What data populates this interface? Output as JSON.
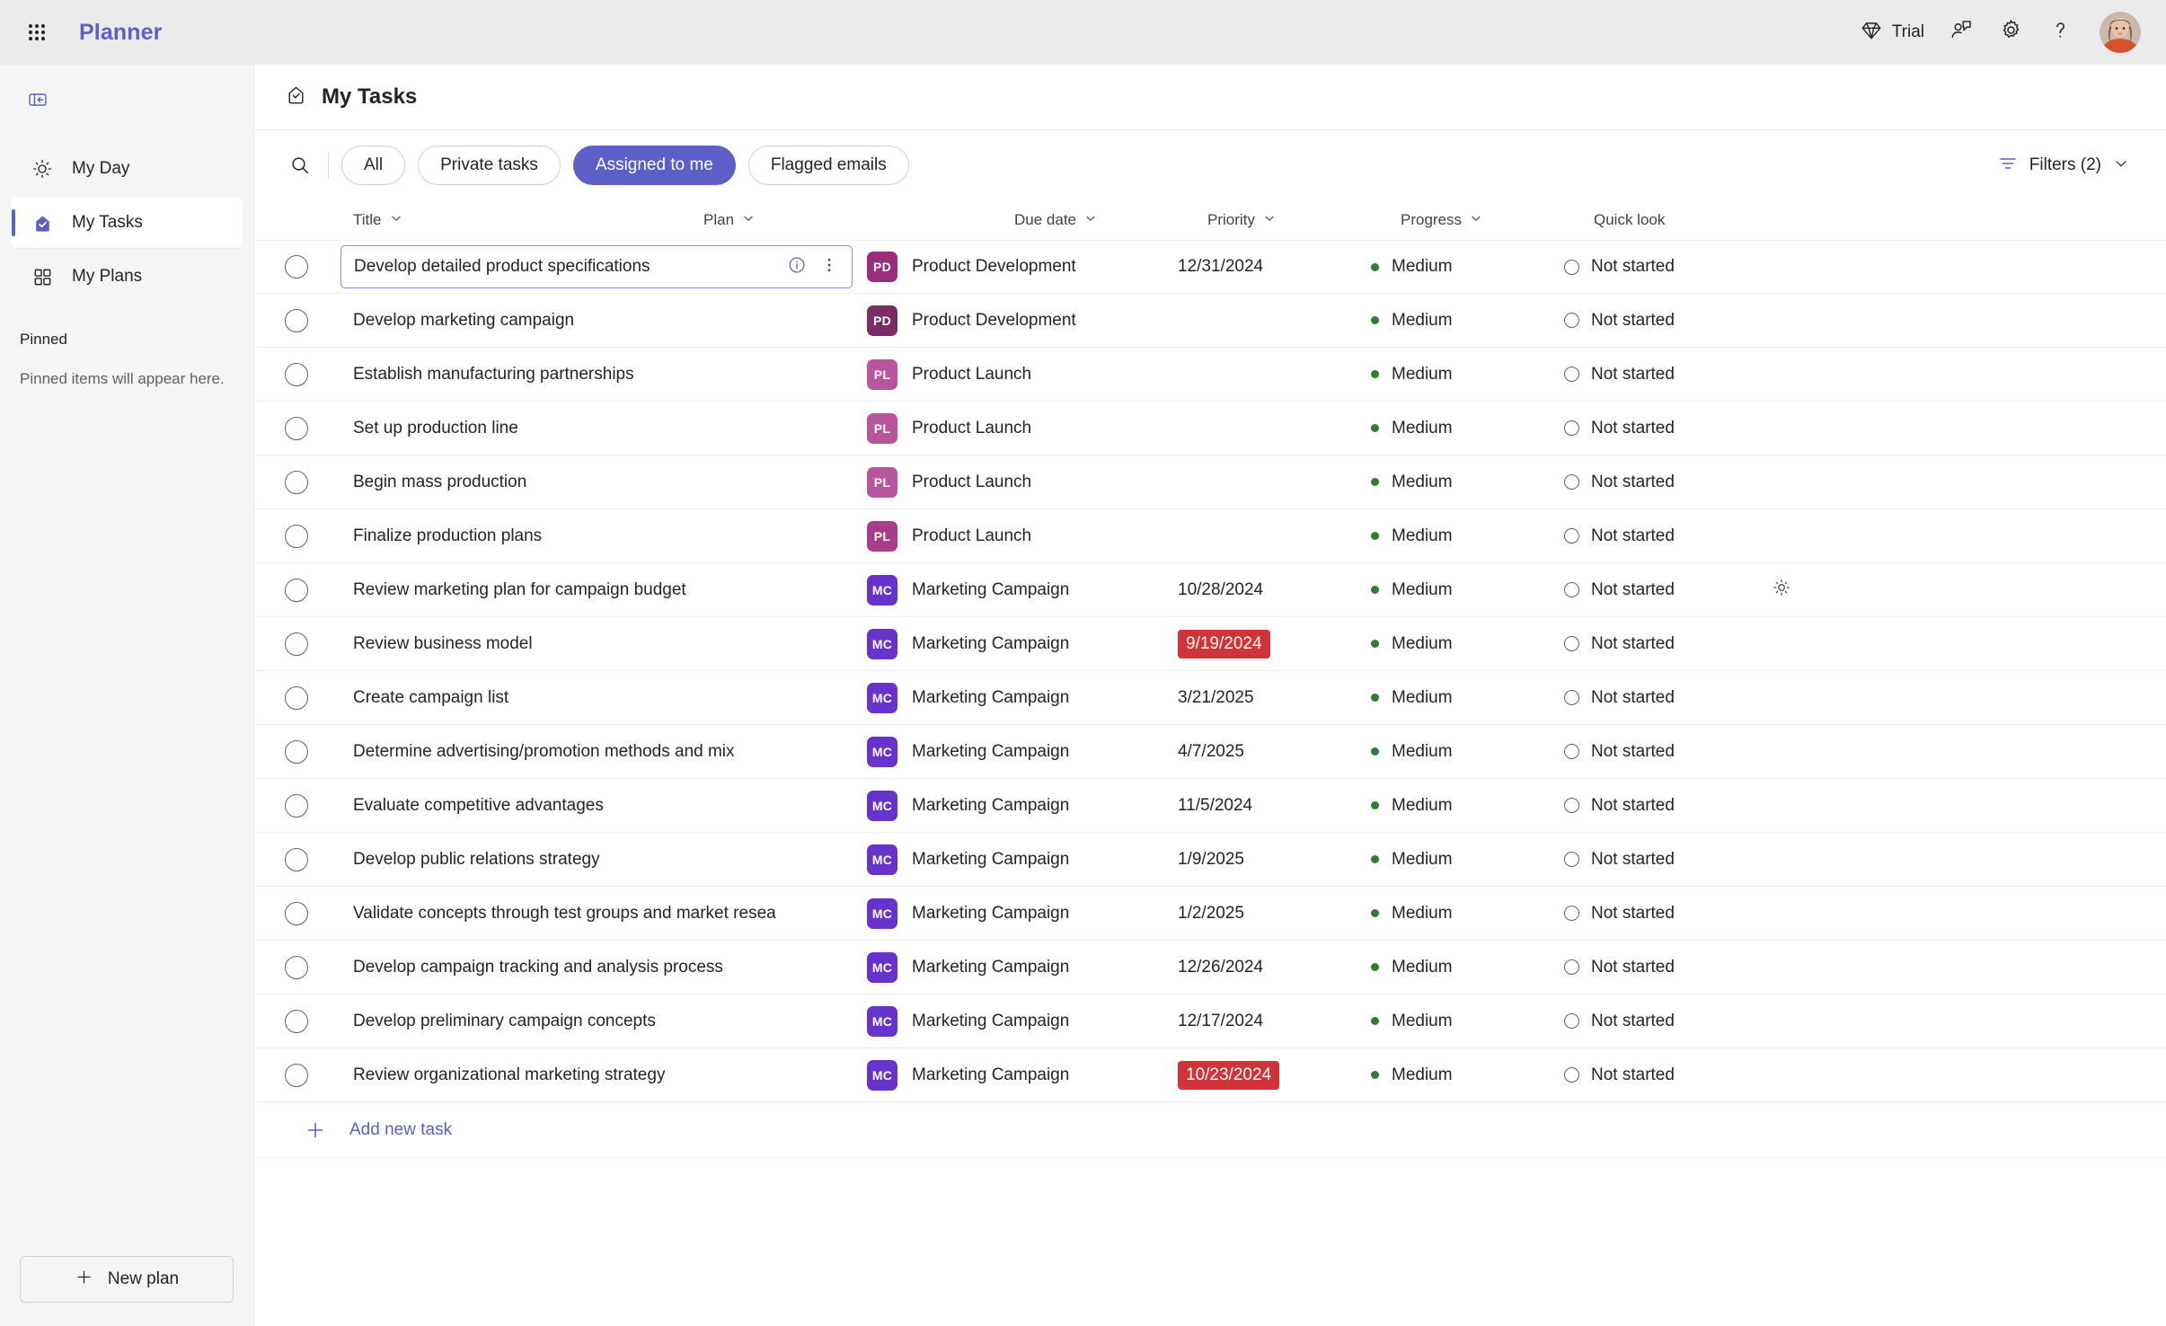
{
  "topbar": {
    "waffle_label": "app-launcher",
    "app_title": "Planner",
    "trial_label": "Trial",
    "icons": [
      "diamond-icon",
      "feedback-icon",
      "gear-icon",
      "help-icon",
      "avatar"
    ]
  },
  "sidebar": {
    "collapse_label": "collapse-navigation",
    "items": [
      {
        "label": "My Day",
        "icon": "sun-icon",
        "active": false
      },
      {
        "label": "My Tasks",
        "icon": "tasks-home-icon",
        "active": true
      },
      {
        "label": "My Plans",
        "icon": "grid-icon",
        "active": false
      }
    ],
    "pinned_heading": "Pinned",
    "pinned_empty": "Pinned items will appear here.",
    "new_plan_label": "New plan"
  },
  "page": {
    "title": "My Tasks",
    "title_icon": "tasks-home-icon"
  },
  "toolbar": {
    "search_label": "search-icon",
    "chips": [
      {
        "label": "All",
        "selected": false
      },
      {
        "label": "Private tasks",
        "selected": false
      },
      {
        "label": "Assigned to me",
        "selected": true
      },
      {
        "label": "Flagged emails",
        "selected": false
      }
    ],
    "filters_label": "Filters (2)"
  },
  "table": {
    "columns": [
      {
        "label": "Title",
        "sortable": true
      },
      {
        "label": "Plan",
        "sortable": true
      },
      {
        "label": "Due date",
        "sortable": true
      },
      {
        "label": "Priority",
        "sortable": true
      },
      {
        "label": "Progress",
        "sortable": true
      },
      {
        "label": "Quick look",
        "sortable": false
      }
    ],
    "add_task_label": "Add new task",
    "rows": [
      {
        "title": "Develop detailed product specifications",
        "plan": "Product Development",
        "plan_initials": "PD",
        "plan_color": "#9B2D7E",
        "due": "12/31/2024",
        "overdue": false,
        "priority": "Medium",
        "priority_color": "#2E7D32",
        "progress": "Not started",
        "focused": true,
        "quick_look": ""
      },
      {
        "title": "Develop marketing campaign",
        "plan": "Product Development",
        "plan_initials": "PD",
        "plan_color": "#7B2B66",
        "due": "",
        "overdue": false,
        "priority": "Medium",
        "priority_color": "#2E7D32",
        "progress": "Not started",
        "focused": false,
        "quick_look": ""
      },
      {
        "title": "Establish manufacturing partnerships",
        "plan": "Product Launch",
        "plan_initials": "PL",
        "plan_color": "#B8559C",
        "due": "",
        "overdue": false,
        "priority": "Medium",
        "priority_color": "#2E7D32",
        "progress": "Not started",
        "focused": false,
        "quick_look": ""
      },
      {
        "title": "Set up production line",
        "plan": "Product Launch",
        "plan_initials": "PL",
        "plan_color": "#B8559C",
        "due": "",
        "overdue": false,
        "priority": "Medium",
        "priority_color": "#2E7D32",
        "progress": "Not started",
        "focused": false,
        "quick_look": ""
      },
      {
        "title": "Begin mass production",
        "plan": "Product Launch",
        "plan_initials": "PL",
        "plan_color": "#B8559C",
        "due": "",
        "overdue": false,
        "priority": "Medium",
        "priority_color": "#2E7D32",
        "progress": "Not started",
        "focused": false,
        "quick_look": ""
      },
      {
        "title": "Finalize production plans",
        "plan": "Product Launch",
        "plan_initials": "PL",
        "plan_color": "#A83D8C",
        "due": "",
        "overdue": false,
        "priority": "Medium",
        "priority_color": "#2E7D32",
        "progress": "Not started",
        "focused": false,
        "quick_look": ""
      },
      {
        "title": "Review marketing plan for campaign budget",
        "plan": "Marketing Campaign",
        "plan_initials": "MC",
        "plan_color": "#6633CC",
        "due": "10/28/2024",
        "overdue": false,
        "priority": "Medium",
        "priority_color": "#2E7D32",
        "progress": "Not started",
        "focused": false,
        "quick_look": "my-day-sun-icon"
      },
      {
        "title": "Review business model",
        "plan": "Marketing Campaign",
        "plan_initials": "MC",
        "plan_color": "#6633CC",
        "due": "9/19/2024",
        "overdue": true,
        "priority": "Medium",
        "priority_color": "#2E7D32",
        "progress": "Not started",
        "focused": false,
        "quick_look": ""
      },
      {
        "title": "Create campaign list",
        "plan": "Marketing Campaign",
        "plan_initials": "MC",
        "plan_color": "#6633CC",
        "due": "3/21/2025",
        "overdue": false,
        "priority": "Medium",
        "priority_color": "#2E7D32",
        "progress": "Not started",
        "focused": false,
        "quick_look": ""
      },
      {
        "title": "Determine advertising/promotion methods and mix",
        "plan": "Marketing Campaign",
        "plan_initials": "MC",
        "plan_color": "#6633CC",
        "due": "4/7/2025",
        "overdue": false,
        "priority": "Medium",
        "priority_color": "#2E7D32",
        "progress": "Not started",
        "focused": false,
        "quick_look": ""
      },
      {
        "title": "Evaluate competitive advantages",
        "plan": "Marketing Campaign",
        "plan_initials": "MC",
        "plan_color": "#6633CC",
        "due": "11/5/2024",
        "overdue": false,
        "priority": "Medium",
        "priority_color": "#2E7D32",
        "progress": "Not started",
        "focused": false,
        "quick_look": ""
      },
      {
        "title": "Develop public relations strategy",
        "plan": "Marketing Campaign",
        "plan_initials": "MC",
        "plan_color": "#6633CC",
        "due": "1/9/2025",
        "overdue": false,
        "priority": "Medium",
        "priority_color": "#2E7D32",
        "progress": "Not started",
        "focused": false,
        "quick_look": ""
      },
      {
        "title": "Validate concepts through test groups and market resea",
        "plan": "Marketing Campaign",
        "plan_initials": "MC",
        "plan_color": "#6633CC",
        "due": "1/2/2025",
        "overdue": false,
        "priority": "Medium",
        "priority_color": "#2E7D32",
        "progress": "Not started",
        "focused": false,
        "quick_look": ""
      },
      {
        "title": "Develop campaign tracking and analysis process",
        "plan": "Marketing Campaign",
        "plan_initials": "MC",
        "plan_color": "#6633CC",
        "due": "12/26/2024",
        "overdue": false,
        "priority": "Medium",
        "priority_color": "#2E7D32",
        "progress": "Not started",
        "focused": false,
        "quick_look": ""
      },
      {
        "title": "Develop preliminary campaign concepts",
        "plan": "Marketing Campaign",
        "plan_initials": "MC",
        "plan_color": "#6633CC",
        "due": "12/17/2024",
        "overdue": false,
        "priority": "Medium",
        "priority_color": "#2E7D32",
        "progress": "Not started",
        "focused": false,
        "quick_look": ""
      },
      {
        "title": "Review organizational marketing strategy",
        "plan": "Marketing Campaign",
        "plan_initials": "MC",
        "plan_color": "#6633CC",
        "due": "10/23/2024",
        "overdue": true,
        "priority": "Medium",
        "priority_color": "#2E7D32",
        "progress": "Not started",
        "focused": false,
        "quick_look": ""
      }
    ]
  }
}
